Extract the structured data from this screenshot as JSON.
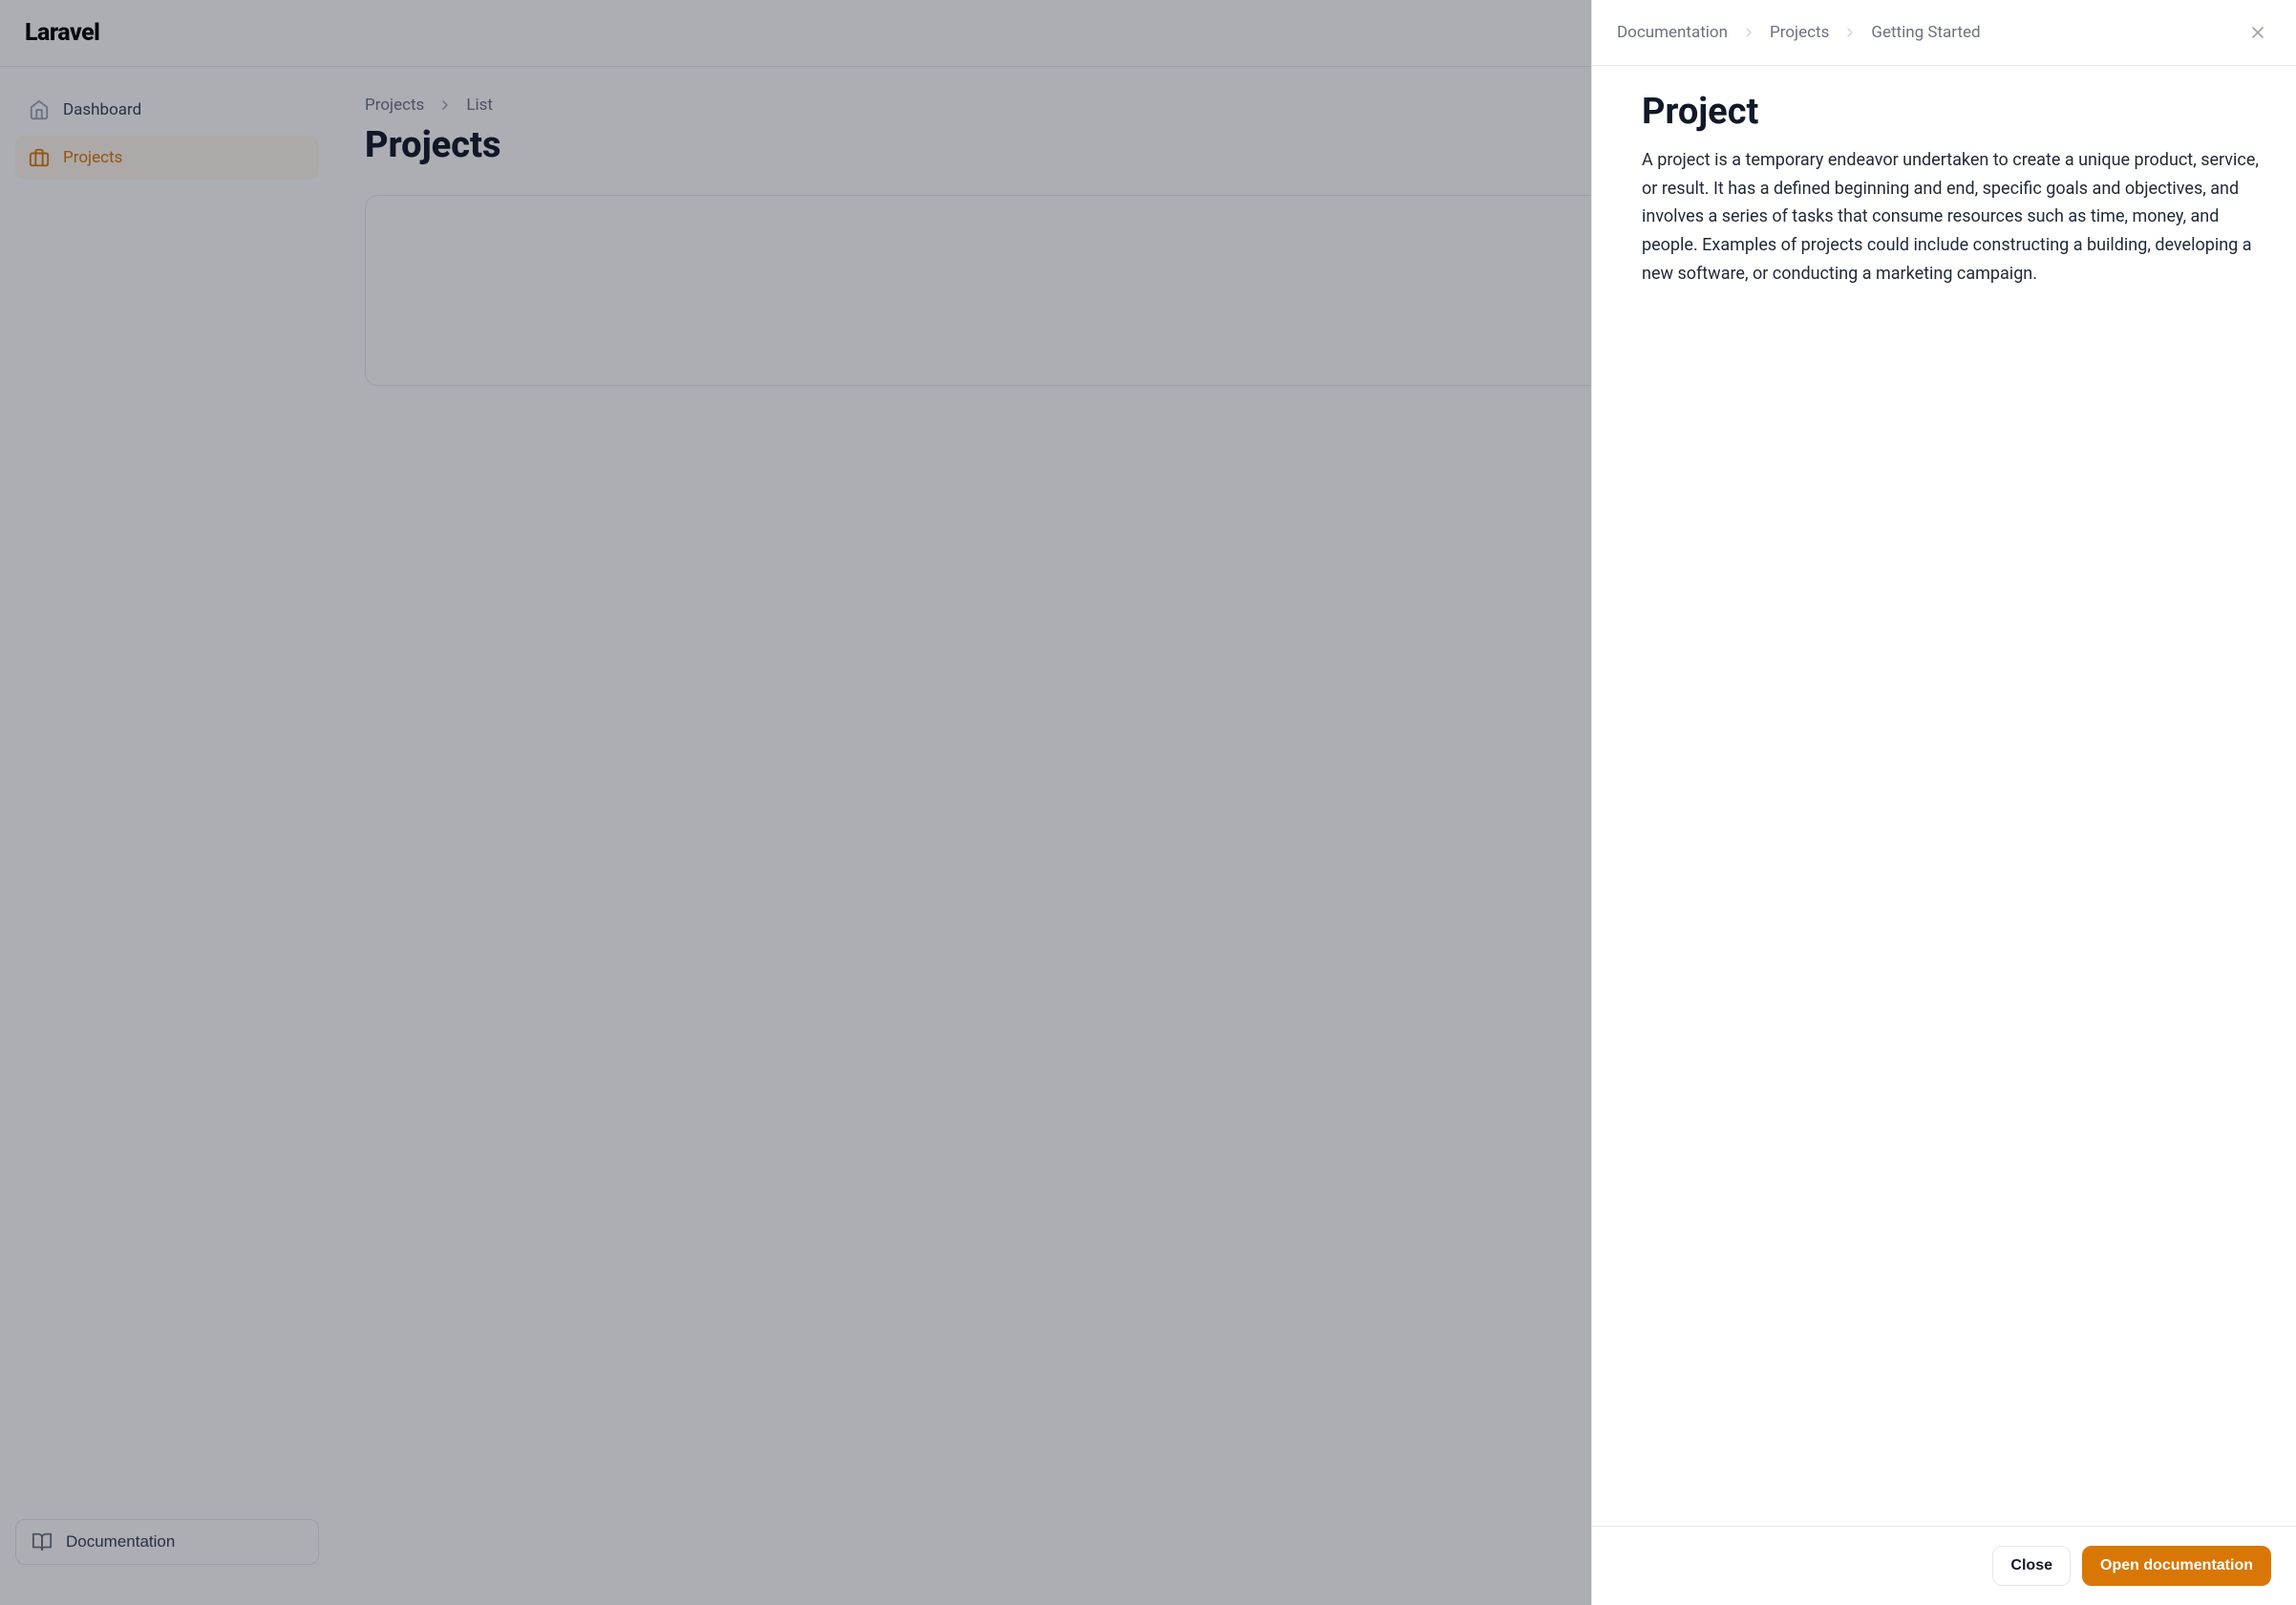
{
  "header": {
    "logo": "Laravel"
  },
  "sidebar": {
    "items": [
      {
        "label": "Dashboard"
      },
      {
        "label": "Projects"
      }
    ],
    "documentation_label": "Documentation"
  },
  "main": {
    "breadcrumb": {
      "items": [
        "Projects",
        "List"
      ]
    },
    "page_title": "Projects"
  },
  "panel": {
    "breadcrumb": {
      "items": [
        "Documentation",
        "Projects",
        "Getting Started"
      ]
    },
    "title": "Project",
    "body": "A project is a temporary endeavor undertaken to create a unique product, service, or result. It has a defined beginning and end, specific goals and objectives, and involves a series of tasks that consume resources such as time, money, and people. Examples of projects could include constructing a building, developing a new software, or conducting a marketing campaign.",
    "footer": {
      "close_label": "Close",
      "open_label": "Open documentation"
    }
  }
}
